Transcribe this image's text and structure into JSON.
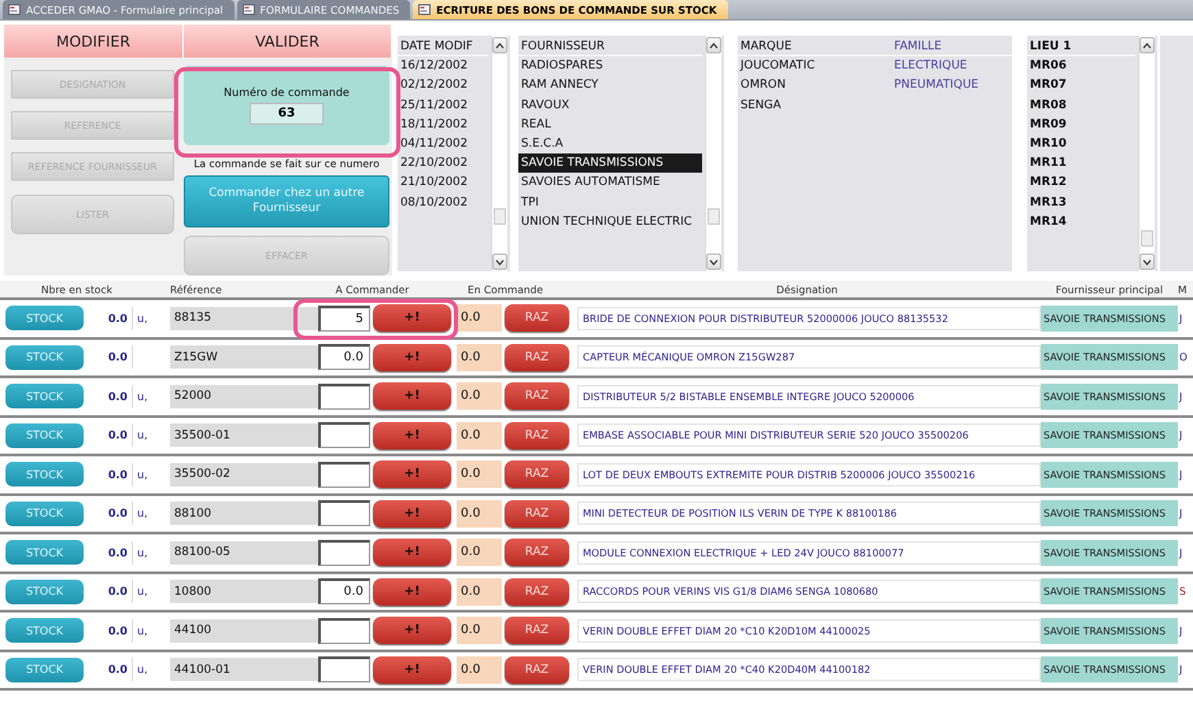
{
  "tabs": [
    {
      "label": "ACCEDER GMAO - Formulaire principal",
      "selected": false
    },
    {
      "label": "FORMULAIRE COMMANDES",
      "selected": false
    },
    {
      "label": "ECRITURE DES BONS DE COMMANDE SUR STOCK",
      "selected": true
    }
  ],
  "header_buttons": [
    "MODIFIER",
    "VALIDER"
  ],
  "sort_buttons": [
    {
      "label": "DESIGNATION",
      "disabled": true
    },
    {
      "label": "REFERENCE",
      "disabled": true
    },
    {
      "label": "REFERENCE FOURNISSEUR",
      "disabled": true
    },
    {
      "label": "LISTER",
      "disabled": true
    }
  ],
  "order_number": {
    "label": "Numéro de commande",
    "value": "63",
    "highlighted": true
  },
  "order_note": "La commande se fait sur ce numero",
  "other_supplier_button": {
    "label": "Commander chez un autre Fournisseur",
    "disabled": false
  },
  "clear_button": {
    "label": "EFFACER",
    "disabled": true
  },
  "date_list": {
    "header": "DATE MODIF",
    "items": [
      "16/12/2002",
      "02/12/2002",
      "25/11/2002",
      "18/11/2002",
      "04/11/2002",
      "22/10/2002",
      "21/10/2002",
      "08/10/2002"
    ]
  },
  "supplier_list": {
    "header": "FOURNISSEUR",
    "items": [
      {
        "label": "RADIOSPARES",
        "selected": false
      },
      {
        "label": "RAM ANNECY",
        "selected": false
      },
      {
        "label": "RAVOUX",
        "selected": false
      },
      {
        "label": "REAL",
        "selected": false
      },
      {
        "label": "S.E.C.A",
        "selected": false
      },
      {
        "label": "SAVOIE TRANSMISSIONS",
        "selected": true
      },
      {
        "label": "SAVOIES AUTOMATISME",
        "selected": false
      },
      {
        "label": "TPI",
        "selected": false
      },
      {
        "label": "UNION TECHNIQUE ELECTRIC",
        "selected": false
      }
    ]
  },
  "brand_list": {
    "headers": [
      "MARQUE",
      "FAMILLE"
    ],
    "rows": [
      [
        "JOUCOMATIC",
        "ELECTRIQUE"
      ],
      [
        "OMRON",
        "PNEUMATIQUE"
      ],
      [
        "SENGA",
        ""
      ]
    ]
  },
  "location_list": {
    "header": "LIEU 1",
    "items": [
      "MR06",
      "MR07",
      "MR08",
      "MR09",
      "MR10",
      "MR11",
      "MR12",
      "MR13",
      "MR14"
    ]
  },
  "table": {
    "columns": [
      "Nbre en stock",
      "Référence",
      "A Commander",
      "En Commande",
      "Désignation",
      "Fournisseur principal",
      "M"
    ],
    "rows": [
      {
        "stock_button": "STOCK",
        "add_button": "+!",
        "reset_button": "RAZ",
        "stock": "0.0",
        "unit": "u,",
        "reference": "88135",
        "to_order": "5",
        "ordered": "0.0",
        "designation": "BRIDE DE CONNEXION POUR DISTRIBUTEUR 52000006  JOUCO 88135532",
        "supplier": "SAVOIE TRANSMISSIONS",
        "column_7": "J",
        "highlighted": true
      },
      {
        "stock_button": "STOCK",
        "add_button": "+!",
        "reset_button": "RAZ",
        "stock": "0.0",
        "unit": "",
        "reference": "Z15GW",
        "to_order": "0.0",
        "ordered": "0.0",
        "designation": "CAPTEUR MÉCANIQUE OMRON   Z15GW287",
        "supplier": "SAVOIE TRANSMISSIONS",
        "column_7": "O",
        "highlighted": false
      },
      {
        "stock_button": "STOCK",
        "add_button": "+!",
        "reset_button": "RAZ",
        "stock": "0.0",
        "unit": "u,",
        "reference": "52000",
        "to_order": "",
        "ordered": "0.0",
        "designation": "DISTRIBUTEUR 5/2 BISTABLE ENSEMBLE INTEGRE JOUCO 5200006",
        "supplier": "SAVOIE TRANSMISSIONS",
        "column_7": "J",
        "highlighted": false
      },
      {
        "stock_button": "STOCK",
        "add_button": "+!",
        "reset_button": "RAZ",
        "stock": "0.0",
        "unit": "u,",
        "reference": "35500-01",
        "to_order": "",
        "ordered": "0.0",
        "designation": "EMBASE ASSOCIABLE POUR MINI DISTRIBUTEUR SERIE 520 JOUCO 35500206",
        "supplier": "SAVOIE TRANSMISSIONS",
        "column_7": "J",
        "highlighted": false
      },
      {
        "stock_button": "STOCK",
        "add_button": "+!",
        "reset_button": "RAZ",
        "stock": "0.0",
        "unit": "u,",
        "reference": "35500-02",
        "to_order": "",
        "ordered": "0.0",
        "designation": "LOT DE DEUX EMBOUTS EXTREMITE POUR DISTRIB 5200006  JOUCO 35500216",
        "supplier": "SAVOIE TRANSMISSIONS",
        "column_7": "J",
        "highlighted": false
      },
      {
        "stock_button": "STOCK",
        "add_button": "+!",
        "reset_button": "RAZ",
        "stock": "0.0",
        "unit": "u,",
        "reference": "88100",
        "to_order": "",
        "ordered": "0.0",
        "designation": "MINI DETECTEUR DE POSITION ILS VERIN DE TYPE K  88100186",
        "supplier": "SAVOIE TRANSMISSIONS",
        "column_7": "J",
        "highlighted": false
      },
      {
        "stock_button": "STOCK",
        "add_button": "+!",
        "reset_button": "RAZ",
        "stock": "0.0",
        "unit": "u,",
        "reference": "88100-05",
        "to_order": "",
        "ordered": "0.0",
        "designation": "MODULE CONNEXION ELECTRIQUE + LED 24V JOUCO 88100077",
        "supplier": "SAVOIE TRANSMISSIONS",
        "column_7": "J",
        "highlighted": false
      },
      {
        "stock_button": "STOCK",
        "add_button": "+!",
        "reset_button": "RAZ",
        "stock": "0.0",
        "unit": "u,",
        "reference": "10800",
        "to_order": "0.0",
        "ordered": "0.0",
        "designation": "RACCORDS POUR VERINS VIS G1/8 DIAM6 SENGA 1080680",
        "supplier": "SAVOIE TRANSMISSIONS",
        "column_7": "S",
        "highlighted": false
      },
      {
        "stock_button": "STOCK",
        "add_button": "+!",
        "reset_button": "RAZ",
        "stock": "0.0",
        "unit": "u,",
        "reference": "44100",
        "to_order": "",
        "ordered": "0.0",
        "designation": "VERIN DOUBLE EFFET DIAM 20 *C10 K20D10M   44100025",
        "supplier": "SAVOIE TRANSMISSIONS",
        "column_7": "J",
        "highlighted": false
      },
      {
        "stock_button": "STOCK",
        "add_button": "+!",
        "reset_button": "RAZ",
        "stock": "0.0",
        "unit": "u,",
        "reference": "44100-01",
        "to_order": "",
        "ordered": "0.0",
        "designation": "VERIN DOUBLE EFFET DIAM 20 *C40 K20D40M   44100182",
        "supplier": "SAVOIE TRANSMISSIONS",
        "column_7": "J",
        "highlighted": false
      }
    ]
  }
}
